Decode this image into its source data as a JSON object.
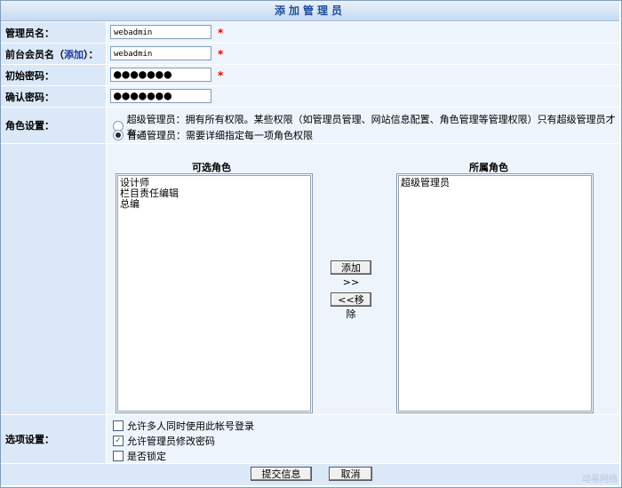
{
  "title": "添加管理员",
  "fields": {
    "admin_name": {
      "label": "管理员名：",
      "value": "webadmin"
    },
    "frontend_member": {
      "label_prefix": "前台会员名（",
      "link": "添加",
      "label_suffix": "）：",
      "value": "webadmin"
    },
    "initial_password": {
      "label": "初始密码：",
      "value": "●●●●●●●"
    },
    "confirm_password": {
      "label": "确认密码：",
      "value": "●●●●●●●"
    }
  },
  "required_mark": "*",
  "roles": {
    "label": "角色设置：",
    "options": [
      {
        "text": "超级管理员：拥有所有权限。某些权限（如管理员管理、网站信息配置、角色管理等管理权限）只有超级管理员才有。",
        "selected": false
      },
      {
        "text": "普通管理员：需要详细指定每一项角色权限",
        "selected": true
      }
    ],
    "available_title": "可选角色",
    "available": [
      "设计师",
      "栏目责任编辑",
      "总编"
    ],
    "assigned_title": "所属角色",
    "assigned": [
      "超级管理员"
    ],
    "add_button": "添加>>",
    "remove_button": "<<移除"
  },
  "options": {
    "label": "选项设置：",
    "items": [
      {
        "text": "允许多人同时使用此帐号登录",
        "checked": false
      },
      {
        "text": "允许管理员修改密码",
        "checked": true
      },
      {
        "text": "是否锁定",
        "checked": false
      }
    ]
  },
  "submit_button": "提交信息",
  "cancel_button": "取消",
  "watermark": "动易网络"
}
